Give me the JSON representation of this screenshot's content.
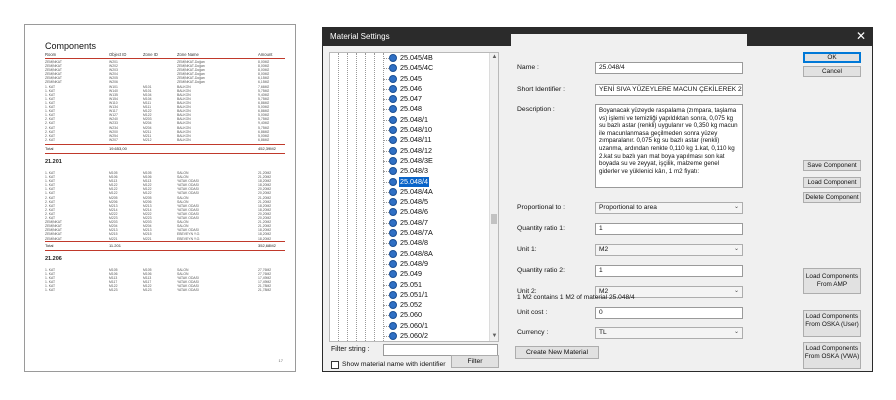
{
  "report": {
    "title": "Components",
    "headers": [
      "Room",
      "Object ID",
      "Zone ID",
      "Zone Name",
      "Amount"
    ],
    "section1_rows": [
      [
        "ZEMİNKAT",
        "W201",
        "",
        "ZEMİNKAT-Doğarı",
        "8,00M2"
      ],
      [
        "ZEMİNKAT",
        "W202",
        "",
        "ZEMİNKAT-Doğarı",
        "8,00M2"
      ],
      [
        "ZEMİNKAT",
        "W203",
        "",
        "ZEMİNKAT-Doğarı",
        "8,00M2"
      ],
      [
        "ZEMİNKAT",
        "W204",
        "",
        "ZEMİNKAT-Doğarı",
        "8,00M2"
      ],
      [
        "ZEMİNKAT",
        "W205",
        "",
        "ZEMİNKAT-Doğarı",
        "6,15M2"
      ],
      [
        "ZEMİNKAT",
        "W206",
        "",
        "ZEMİNKAT-Doğarı",
        "6,15M2"
      ],
      [
        "1. KAT",
        "W101",
        "M101",
        "BALKON",
        "7,66M2"
      ],
      [
        "1. KAT",
        "W140",
        "M101",
        "BALKON",
        "5,75M2"
      ],
      [
        "1. KAT",
        "W135",
        "M104",
        "BALKON",
        "9,40M2"
      ],
      [
        "1. KAT",
        "W154",
        "M104",
        "BALKON",
        "5,75M2"
      ],
      [
        "1. KAT",
        "W110",
        "M111",
        "BALKON",
        "6,86M2"
      ],
      [
        "1. KAT",
        "W134",
        "M111",
        "BALKON",
        "5,00M2"
      ],
      [
        "1. KAT",
        "W117",
        "M122",
        "BALKON",
        "6,86M2"
      ],
      [
        "1. KAT",
        "W127",
        "M122",
        "BALKON",
        "5,00M2"
      ],
      [
        "2. KAT",
        "W240",
        "M203",
        "BALKON",
        "5,75M2"
      ],
      [
        "2. KAT",
        "W233",
        "M204",
        "BALKON",
        "9,40M2"
      ],
      [
        "2. KAT",
        "W234",
        "M204",
        "BALKON",
        "5,75M2"
      ],
      [
        "2. KAT",
        "W200",
        "M211",
        "BALKON",
        "6,86M2"
      ],
      [
        "2. KAT",
        "W254",
        "M211",
        "BALKON",
        "5,00M2"
      ],
      [
        "2. KAT",
        "W207",
        "M212",
        "BALKON",
        "6,86M2"
      ]
    ],
    "section1_total": [
      "Total",
      "19.653,00",
      "",
      "",
      "452,39M2"
    ],
    "group2": "21.201",
    "section2_rows": [
      [
        "1. KAT",
        "M105",
        "M105",
        "SALON",
        "21,20M2"
      ],
      [
        "1. KAT",
        "M106",
        "M106",
        "SALON",
        "21,20M2"
      ],
      [
        "1. KAT",
        "M113",
        "M113",
        "YATAK ODASI",
        "18,20M2"
      ],
      [
        "1. KAT",
        "M122",
        "M122",
        "YATAK ODASI",
        "18,20M2"
      ],
      [
        "1. KAT",
        "M122",
        "M122",
        "YATAK ODASI",
        "20,20M2"
      ],
      [
        "1. KAT",
        "M122",
        "M122",
        "YATAK ODASI",
        "20,20M2"
      ],
      [
        "2. KAT",
        "M205",
        "M205",
        "SALON",
        "21,20M2"
      ],
      [
        "2. KAT",
        "M206",
        "M206",
        "SALON",
        "21,20M2"
      ],
      [
        "2. KAT",
        "M213",
        "M213",
        "YATAK ODASI",
        "18,20M2"
      ],
      [
        "2. KAT",
        "M214",
        "M214",
        "YATAK ODASI",
        "18,20M2"
      ],
      [
        "2. KAT",
        "M222",
        "M222",
        "YATAK ODASI",
        "20,20M2"
      ],
      [
        "2. KAT",
        "M223",
        "M223",
        "YATAK ODASI",
        "20,20M2"
      ],
      [
        "ZEMİNKAT",
        "M203",
        "M203",
        "SALON",
        "21,20M2"
      ],
      [
        "ZEMİNKAT",
        "M204",
        "M204",
        "SALON",
        "21,20M2"
      ],
      [
        "ZEMİNKAT",
        "M213",
        "M213",
        "YATAK ODASI",
        "18,20M2"
      ],
      [
        "ZEMİNKAT",
        "M215",
        "M215",
        "EBEVEYN Y.O.",
        "18,20M2"
      ],
      [
        "ZEMİNKAT",
        "M221",
        "M221",
        "EBEVEYN Y.O.",
        "18,20M2"
      ]
    ],
    "section2_total": [
      "Total",
      "11.201",
      "",
      "",
      "352,68M2"
    ],
    "group3": "21.206",
    "section3_rows": [
      [
        "1. KAT",
        "M105",
        "M105",
        "SALON",
        "27,76M2"
      ],
      [
        "1. KAT",
        "M106",
        "M106",
        "SALON",
        "27,76M2"
      ],
      [
        "1. KAT",
        "M113",
        "M113",
        "YATAK ODASI",
        "17,49M2"
      ],
      [
        "1. KAT",
        "M117",
        "M117",
        "YATAK ODASI",
        "17,49M2"
      ],
      [
        "1. KAT",
        "M122",
        "M122",
        "YATAK ODASI",
        "21,78M2"
      ],
      [
        "1. KAT",
        "M123",
        "M123",
        "YATAK ODASI",
        "21,78M2"
      ]
    ],
    "page_number": "17"
  },
  "dialog": {
    "title": "Material Settings",
    "close_glyph": "✕",
    "tree_items": [
      "25.045/4B",
      "25.045/4C",
      "25.045",
      "25.046",
      "25.047",
      "25.048",
      "25.048/1",
      "25.048/10",
      "25.048/11",
      "25.048/12",
      "25.048/3E",
      "25.048/3",
      "25.048/4",
      "25.048/4A",
      "25.048/5",
      "25.048/6",
      "25.048/7",
      "25.048/7A",
      "25.048/8",
      "25.048/8A",
      "25.048/9",
      "25.049",
      "25.051",
      "25.051/1",
      "25.052",
      "25.060",
      "25.060/1",
      "25.060/2",
      "25.060/3",
      "25.061",
      "25.061/1",
      "25.061/2",
      "25.061/3"
    ],
    "selected_item": "25.048/4",
    "filter_label": "Filter string :",
    "filter_value": "",
    "show_identifier_label": "Show material name with identifier",
    "filter_button": "Filter",
    "create_button": "Create New Material",
    "fields": {
      "name_label": "Name :",
      "name_value": "25.048/4",
      "short_id_label": "Short Identifier :",
      "short_id_value": "YENİ SIVA YÜZEYLERE MACUN ÇEKİLEREK 2 KAT YARI",
      "description_label": "Description :",
      "description_value": "Boyanacak yüzeyde raspalama (zımpara, taşlama vs) işlemi ve temizliği yapıldıktan sonra, 0,075 kg su bazlı astar (renkli) uygulanır ve 0,350 kg macun ile macunlanmasa geçilmeden sonra yüzey zımparalanır. 0,075 kg su bazlı astar (renkli) uzanma, ardından renkte 0,110 kg 1.kat, 0,110 kg 2.kat su bazlı yarı mat  boya yapılması son kat boyada su ve zeyyat, işçilik, malzeme genel giderler ve yüklenici kârı, 1 m2 fiyatı:",
      "proportional_label": "Proportional to :",
      "proportional_value": "Proportional to area",
      "qty1_label": "Quantity ratio 1:",
      "qty1_value": "1",
      "unit1_label": "Unit 1:",
      "unit1_value": "M2",
      "qty2_label": "Quantity ratio 2:",
      "qty2_value": "1",
      "unit2_label": "Unit 2:",
      "unit2_value": "M2",
      "unit_cost_label": "Unit cost :",
      "unit_cost_value": "0",
      "currency_label": "Currency :",
      "currency_value": "TL",
      "note": "1 M2 contains 1 M2 of material 25.048/4"
    },
    "buttons": {
      "ok": "OK",
      "cancel": "Cancel",
      "save_component": "Save Component",
      "load_component": "Load Component",
      "delete_component": "Delete Component",
      "load_amp": "Load Components From AMP",
      "load_oska_user": "Load Components From OSKA (User)",
      "load_oska_vwa": "Load Components From OSKA (VWA)"
    }
  }
}
